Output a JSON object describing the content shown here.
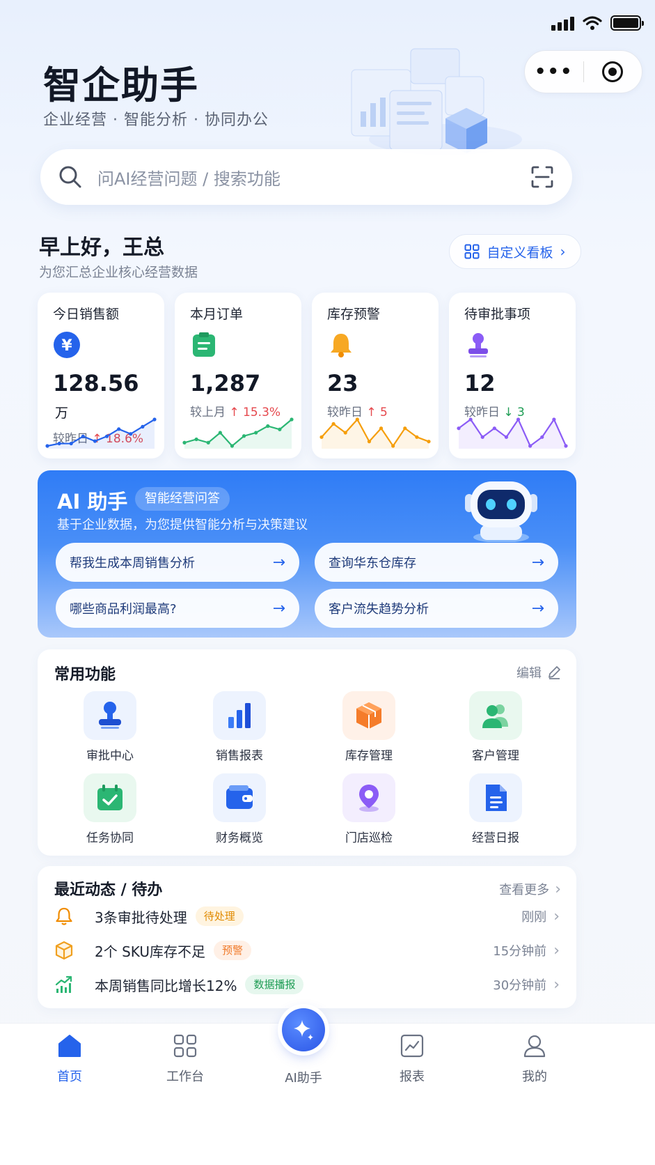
{
  "app": {
    "title": "智企助手",
    "subtitle": "企业经营 · 智能分析 · 协同办公"
  },
  "search": {
    "placeholder": "问AI经营问题 / 搜索功能"
  },
  "greeting": {
    "title": "早上好，王总",
    "subtitle": "为您汇总企业核心经营数据",
    "custom_label": "自定义看板"
  },
  "metrics": [
    {
      "label": "今日销售额",
      "value": "128.56",
      "unit": "万",
      "compare_label": "较昨日",
      "change": "↑ 18.6%",
      "trend": "up",
      "icon": "yuan-icon",
      "color": "#2563eb",
      "spark": [
        3,
        4,
        4,
        7,
        5,
        7,
        10,
        8,
        11,
        14
      ]
    },
    {
      "label": "本月订单",
      "value": "1,287",
      "unit": "",
      "compare_label": "较上月",
      "change": "↑ 15.3%",
      "trend": "up",
      "icon": "clipboard-icon",
      "color": "#2bb673",
      "spark": [
        4,
        5,
        4,
        7,
        3,
        6,
        7,
        9,
        8,
        11
      ]
    },
    {
      "label": "库存预警",
      "value": "23",
      "unit": "",
      "compare_label": "较昨日",
      "change": "↑ 5",
      "trend": "up",
      "icon": "bell-icon",
      "color": "#f59e0b",
      "spark": [
        6,
        9,
        7,
        10,
        5,
        8,
        4,
        8,
        6,
        5
      ]
    },
    {
      "label": "待审批事项",
      "value": "12",
      "unit": "",
      "compare_label": "较昨日",
      "change": "↓ 3",
      "trend": "down",
      "icon": "stamp-icon",
      "color": "#8b5cf6",
      "spark": [
        6,
        7,
        5,
        6,
        5,
        7,
        4,
        5,
        7,
        4
      ]
    }
  ],
  "ai": {
    "title": "AI 助手",
    "tag": "智能经营问答",
    "description": "基于企业数据，为您提供智能分析与决策建议",
    "questions": [
      "帮我生成本周销售分析",
      "查询华东仓库存",
      "哪些商品利润最高?",
      "客户流失趋势分析"
    ]
  },
  "functions": {
    "title": "常用功能",
    "edit_label": "编辑",
    "items": [
      {
        "label": "审批中心",
        "icon": "stamp-icon"
      },
      {
        "label": "销售报表",
        "icon": "bar-chart-icon"
      },
      {
        "label": "库存管理",
        "icon": "box-icon"
      },
      {
        "label": "客户管理",
        "icon": "users-icon"
      },
      {
        "label": "任务协同",
        "icon": "calendar-check-icon"
      },
      {
        "label": "财务概览",
        "icon": "wallet-icon"
      },
      {
        "label": "门店巡检",
        "icon": "location-pin-icon"
      },
      {
        "label": "经营日报",
        "icon": "document-icon"
      }
    ]
  },
  "recent": {
    "title": "最近动态 / 待办",
    "more_label": "查看更多",
    "items": [
      {
        "text": "3条审批待处理",
        "badge": "待处理",
        "time": "刚刚",
        "icon": "bell-icon"
      },
      {
        "text": "2个 SKU库存不足",
        "badge": "预警",
        "time": "15分钟前",
        "icon": "box-icon"
      },
      {
        "text": "本周销售同比增长12%",
        "badge": "数据播报",
        "time": "30分钟前",
        "icon": "trend-up-icon"
      }
    ]
  },
  "tabs": [
    {
      "label": "首页",
      "icon": "home-icon",
      "active": true
    },
    {
      "label": "工作台",
      "icon": "grid-icon"
    },
    {
      "label": "AI助手",
      "icon": "sparkle-icon"
    },
    {
      "label": "报表",
      "icon": "chart-icon"
    },
    {
      "label": "我的",
      "icon": "user-icon"
    }
  ],
  "colors": {
    "primary": "#2563eb",
    "up": "#e5484d",
    "down": "#1f9d55",
    "warning": "#f59e0b"
  }
}
